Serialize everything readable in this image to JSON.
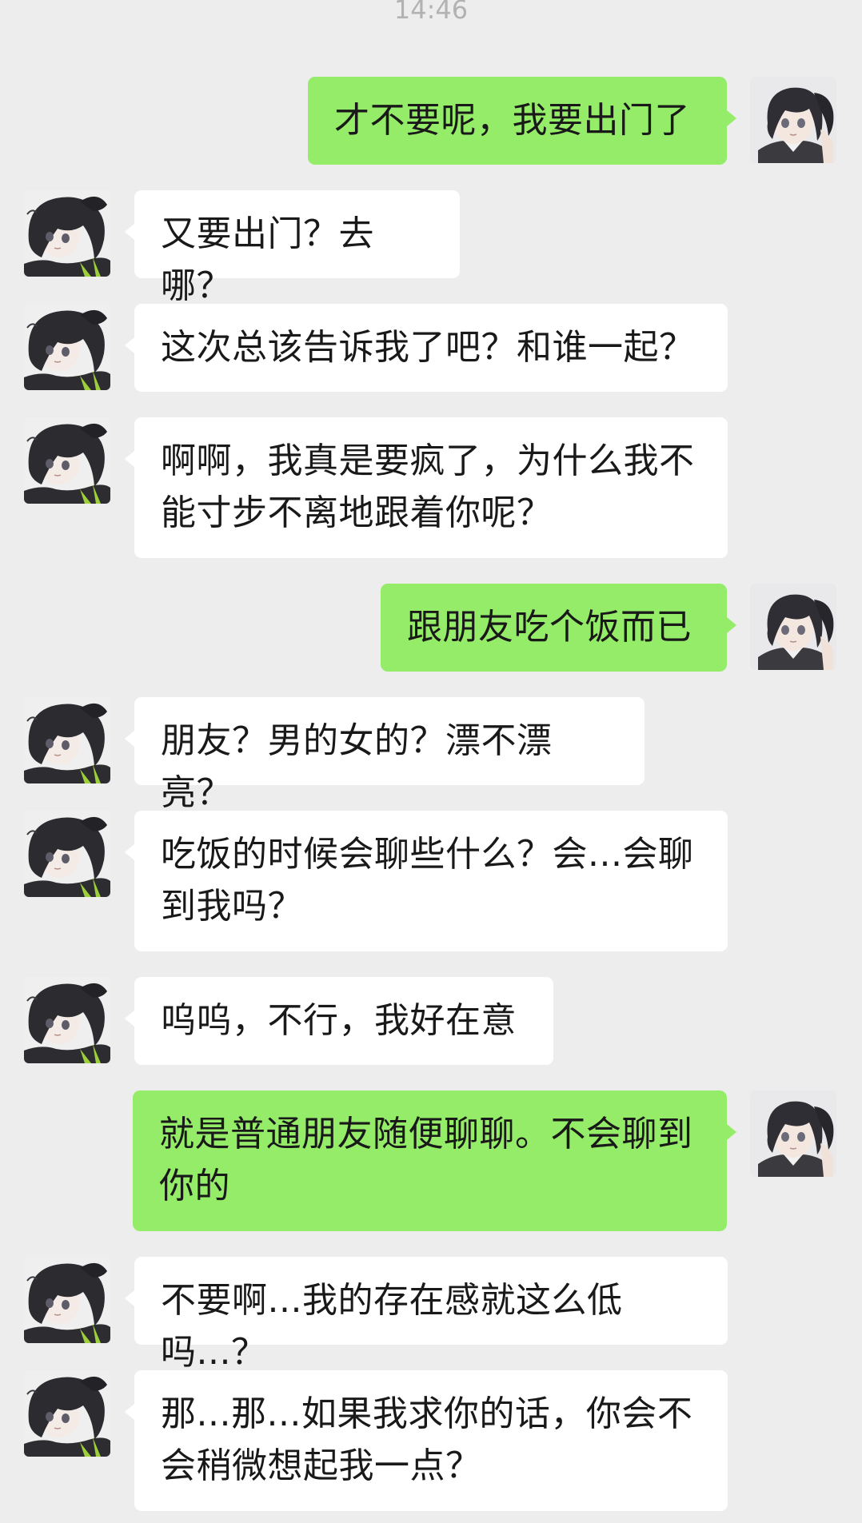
{
  "timestamp": "14:46",
  "colors": {
    "background": "#ededed",
    "incoming_bubble": "#ffffff",
    "outgoing_bubble": "#95ec69",
    "text": "#191919",
    "timestamp": "#b2b2b2"
  },
  "contacts": {
    "me": {
      "avatar_icon": "anime-boy-avatar-icon"
    },
    "other": {
      "avatar_icon": "anime-boy-dark-hair-avatar-icon"
    }
  },
  "messages": [
    {
      "sender": "me",
      "text": "才不要呢，我要出门了"
    },
    {
      "sender": "other",
      "text": "又要出门？去哪？"
    },
    {
      "sender": "other",
      "text": "这次总该告诉我了吧？和谁一起？"
    },
    {
      "sender": "other",
      "text": "啊啊，我真是要疯了，为什么我不能寸步不离地跟着你呢？"
    },
    {
      "sender": "me",
      "text": "跟朋友吃个饭而已"
    },
    {
      "sender": "other",
      "text": "朋友？男的女的？漂不漂亮？"
    },
    {
      "sender": "other",
      "text": "吃饭的时候会聊些什么？会...会聊到我吗？"
    },
    {
      "sender": "other",
      "text": "呜呜，不行，我好在意"
    },
    {
      "sender": "me",
      "text": "就是普通朋友随便聊聊。不会聊到你的"
    },
    {
      "sender": "other",
      "text": "不要啊...我的存在感就这么低吗...？"
    },
    {
      "sender": "other",
      "text": "那...那...如果我求你的话，你会不会稍微想起我一点？"
    }
  ]
}
